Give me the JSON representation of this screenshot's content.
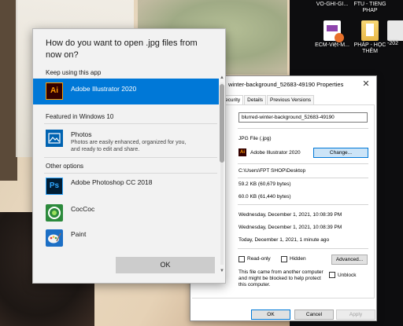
{
  "desktop": {
    "icons": [
      {
        "label": "VO-GHI-GI...",
        "icon": "document-icon"
      },
      {
        "label": "FTU - TIENG PHAP",
        "icon": "folder-icon"
      },
      {
        "label": "ECM-Việt-M...",
        "icon": "document-icon"
      },
      {
        "label": "PHÁP - HỌC THÊM",
        "icon": "folder-icon"
      },
      {
        "label": "-202",
        "icon": "file-icon"
      }
    ]
  },
  "properties_dialog": {
    "title": "winter-background_52683-49190 Properties",
    "tabs": [
      "ecurity",
      "Details",
      "Previous Versions"
    ],
    "filename": "blurred-winter-background_52683-49190",
    "type_of_file": "JPG File (.jpg)",
    "opens_with": "Adobe Illustrator 2020",
    "change_label": "Change...",
    "location": "C:\\Users\\FPT SHOP\\Desktop",
    "size": "59.2 KB (60,679 bytes)",
    "size_on_disk": "60.0 KB (61,440 bytes)",
    "created": "Wednesday, December 1, 2021, 10:08:39 PM",
    "modified": "Wednesday, December 1, 2021, 10:08:39 PM",
    "accessed": "Today, December 1, 2021, 1 minute ago",
    "readonly_label": "Read-only",
    "hidden_label": "Hidden",
    "advanced_label": "Advanced...",
    "security_note": "This file came from another computer and might be blocked to help protect this computer.",
    "unblock_label": "Unblock",
    "ok_label": "OK",
    "cancel_label": "Cancel",
    "apply_label": "Apply"
  },
  "open_with_dialog": {
    "heading": "How do you want to open .jpg files from now on?",
    "keep_using_label": "Keep using this app",
    "featured_label": "Featured in Windows 10",
    "other_label": "Other options",
    "apps": {
      "illustrator": {
        "name": "Adobe Illustrator 2020",
        "icon_text": "Ai"
      },
      "photos": {
        "name": "Photos",
        "desc": "Photos are easily enhanced, organized for you, and ready to edit and share."
      },
      "photoshop": {
        "name": "Adobe Photoshop CC 2018",
        "icon_text": "Ps"
      },
      "coccoc": {
        "name": "CocCoc"
      },
      "paint": {
        "name": "Paint"
      }
    },
    "ok_label": "OK"
  },
  "colors": {
    "accent": "#0078d7",
    "dialog_bg": "#f2f2f2"
  }
}
